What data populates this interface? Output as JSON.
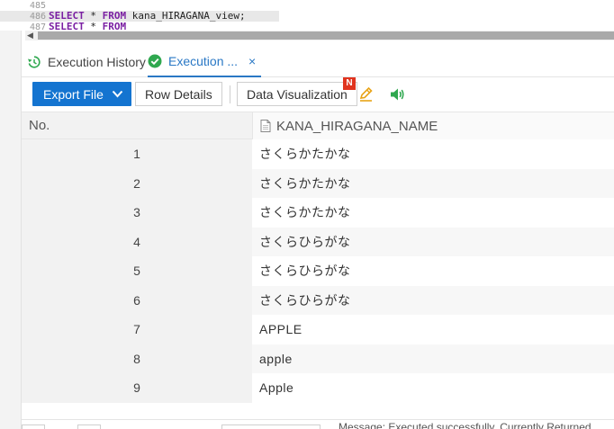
{
  "editor": {
    "lines": [
      {
        "num": "485",
        "kw1": "",
        "mid": "",
        "kw2": "",
        "rest": ""
      },
      {
        "num": "486",
        "kw1": "SELECT",
        "mid": " * ",
        "kw2": "FROM",
        "rest": "  kana_HIRAGANA_view;"
      },
      {
        "num": "487",
        "kw1": "SELECT",
        "mid": " * ",
        "kw2": "FROM",
        "rest": ""
      }
    ]
  },
  "tabs": {
    "history_label": "Execution History",
    "current_label": "Execution ...",
    "close_glyph": "×"
  },
  "toolbar": {
    "export_label": "Export File",
    "export_chevron": "❯",
    "row_details_label": "Row Details",
    "data_viz_label": "Data Visualization",
    "new_badge": "N"
  },
  "table": {
    "columns": [
      "No.",
      "KANA_HIRAGANA_NAME"
    ],
    "rows": [
      {
        "no": "1",
        "name": "さくらかたかな"
      },
      {
        "no": "2",
        "name": "さくらかたかな"
      },
      {
        "no": "3",
        "name": "さくらかたかな"
      },
      {
        "no": "4",
        "name": "さくらひらがな"
      },
      {
        "no": "5",
        "name": "さくらひらがな"
      },
      {
        "no": "6",
        "name": "さくらひらがな"
      },
      {
        "no": "7",
        "name": "APPLE"
      },
      {
        "no": "8",
        "name": "apple"
      },
      {
        "no": "9",
        "name": "Apple"
      }
    ]
  },
  "status": {
    "message": "Message: Executed successfully. Currently Returned"
  },
  "colors": {
    "accent": "#1474d0",
    "tab_active": "#2a78c5",
    "badge": "#e0341f",
    "success": "#2fa84f",
    "keyword": "#7a1fa2"
  },
  "icons": {
    "history": "history-icon",
    "success": "check-circle-icon",
    "chevron": "chevron-down-icon",
    "pen": "pencil-chart-icon",
    "speaker": "speaker-icon",
    "doc": "document-icon"
  }
}
